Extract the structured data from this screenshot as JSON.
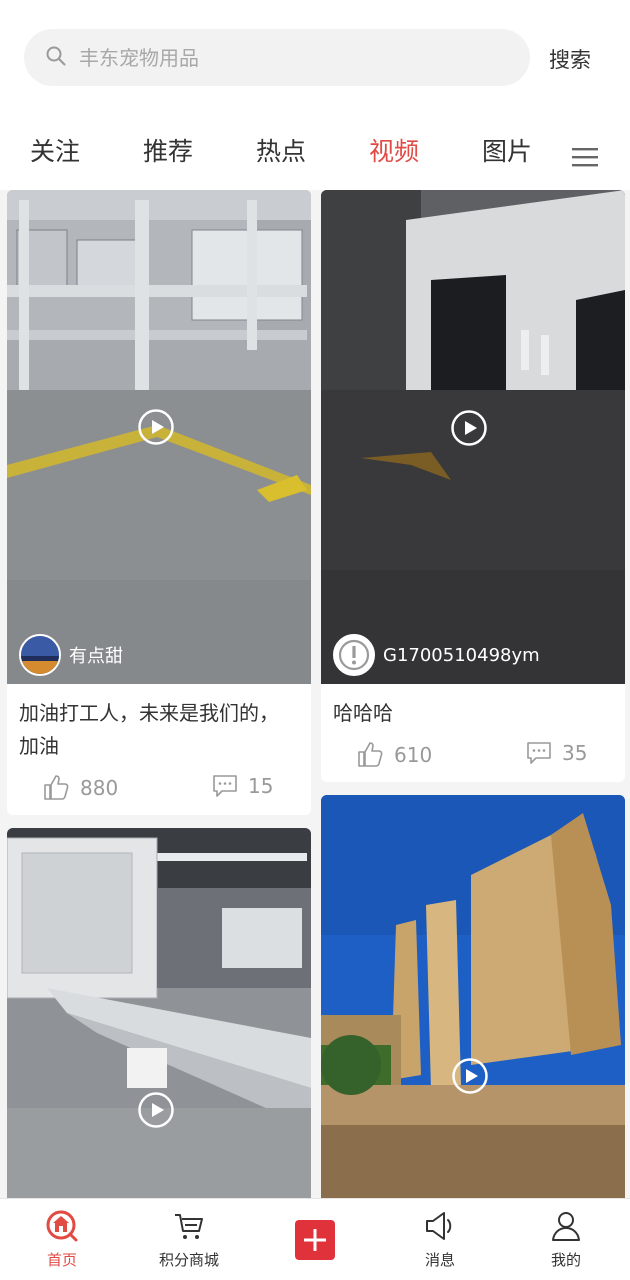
{
  "search": {
    "placeholder": "丰东宠物用品",
    "button": "搜索"
  },
  "tabs": [
    {
      "label": "关注"
    },
    {
      "label": "推荐"
    },
    {
      "label": "热点"
    },
    {
      "label": "视频",
      "active": true
    },
    {
      "label": "图片"
    }
  ],
  "feed": [
    {
      "author": "有点甜",
      "title": "加油打工人，未来是我们的，加油",
      "likes": "880",
      "comments": "15",
      "cover": "factory-floor-video"
    },
    {
      "author": "G1700510498ym",
      "title": "哈哈哈",
      "likes": "610",
      "comments": "35",
      "cover": "machine-room-video"
    },
    {
      "cover": "conveyor-line-video"
    },
    {
      "cover": "stone-forest-video"
    }
  ],
  "nav": [
    {
      "label": "首页",
      "icon": "home-icon",
      "active": true
    },
    {
      "label": "积分商城",
      "icon": "cart-icon"
    },
    {
      "label": "",
      "icon": "plus-icon"
    },
    {
      "label": "消息",
      "icon": "megaphone-icon"
    },
    {
      "label": "我的",
      "icon": "user-icon"
    }
  ],
  "colors": {
    "accent": "#e24a44",
    "publish": "#e0323a",
    "muted": "#999999"
  }
}
